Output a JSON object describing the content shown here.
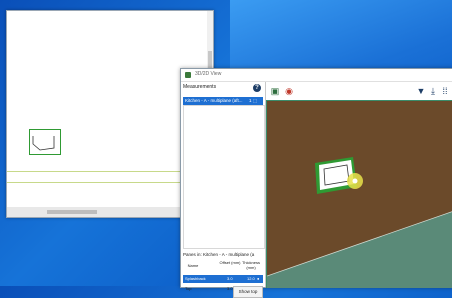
{
  "viewer": {
    "title": "3D/2D View"
  },
  "panel": {
    "heading": "Measurements",
    "help_icon": "?",
    "selected_measurement": "Kitchen - A - multiplane (aft...",
    "measurement_indicator": "1 ⬚"
  },
  "panes": {
    "title": "Panes in: Kitchen - A - multiplane (a",
    "columns": [
      "Name",
      "Offset (mm)",
      "Thickness (mm)"
    ],
    "rows": [
      {
        "name": "Splashback",
        "offset": "3.0",
        "thickness": "12.0",
        "selected": true
      },
      {
        "name": "Top",
        "offset": "3.0",
        "thickness": "30.0",
        "selected": false
      }
    ],
    "show_button": "Show top"
  },
  "toolbar": {
    "icons": [
      "cube-view-icon",
      "color-wheel-icon",
      "filter-icon",
      "download-icon",
      "grid-menu-icon"
    ]
  },
  "colors": {
    "accent": "#1e6fd2",
    "wall": "#6b4a2a",
    "floor": "#5a8a78",
    "highlight": "#e8e24a",
    "frame_green": "#2f9a33"
  }
}
